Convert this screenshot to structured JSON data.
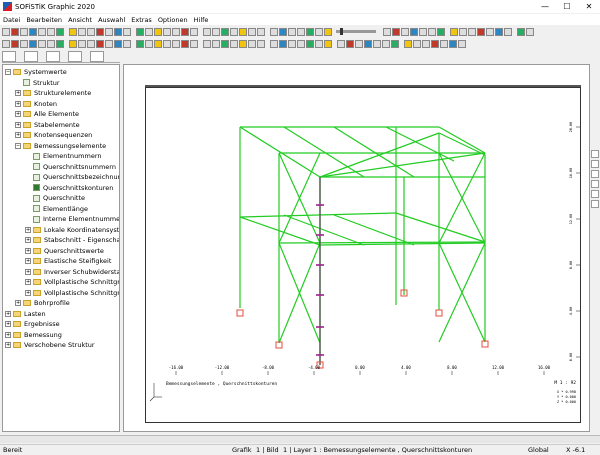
{
  "window": {
    "title": "SOFiSTiK Graphic 2020",
    "min": "—",
    "max": "☐",
    "close": "✕"
  },
  "menu": [
    "Datei",
    "Bearbeiten",
    "Ansicht",
    "Auswahl",
    "Extras",
    "Optionen",
    "Hilfe"
  ],
  "tree": [
    {
      "label": "Systemwerte",
      "level": 0,
      "exp": "−",
      "icon": "folder"
    },
    {
      "label": "Struktur",
      "level": 1,
      "exp": "",
      "icon": "doc"
    },
    {
      "label": "Strukturelemente",
      "level": 1,
      "exp": "+",
      "icon": "folder"
    },
    {
      "label": "Knoten",
      "level": 1,
      "exp": "+",
      "icon": "folder"
    },
    {
      "label": "Alle Elemente",
      "level": 1,
      "exp": "+",
      "icon": "folder"
    },
    {
      "label": "Stabelemente",
      "level": 1,
      "exp": "+",
      "icon": "folder"
    },
    {
      "label": "Knotensequenzen",
      "level": 1,
      "exp": "+",
      "icon": "folder"
    },
    {
      "label": "Bemessungselemente",
      "level": 1,
      "exp": "−",
      "icon": "folder"
    },
    {
      "label": "Elementnummern",
      "level": 2,
      "exp": "",
      "icon": "doc"
    },
    {
      "label": "Querschnittsnummern",
      "level": 2,
      "exp": "",
      "icon": "doc"
    },
    {
      "label": "Querschnittsbezeichnungen",
      "level": 2,
      "exp": "",
      "icon": "doc"
    },
    {
      "label": "Querschnittskonturen",
      "level": 2,
      "exp": "",
      "icon": "bold"
    },
    {
      "label": "Querschnitte",
      "level": 2,
      "exp": "",
      "icon": "doc"
    },
    {
      "label": "Elementlänge",
      "level": 2,
      "exp": "",
      "icon": "doc"
    },
    {
      "label": "Interne Elementnummern",
      "level": 2,
      "exp": "",
      "icon": "doc"
    },
    {
      "label": "Lokale Koordinatensysteme",
      "level": 2,
      "exp": "+",
      "icon": "folder"
    },
    {
      "label": "Stabschnitt - Eigenschaften",
      "level": 2,
      "exp": "+",
      "icon": "folder"
    },
    {
      "label": "Querschnittswerte",
      "level": 2,
      "exp": "+",
      "icon": "folder"
    },
    {
      "label": "Elastische Steifigkeit",
      "level": 2,
      "exp": "+",
      "icon": "folder"
    },
    {
      "label": "Inverser Schubwiderstand",
      "level": 2,
      "exp": "+",
      "icon": "folder"
    },
    {
      "label": "Vollplastische Schnittgröße,",
      "level": 2,
      "exp": "+",
      "icon": "folder"
    },
    {
      "label": "Vollplastische Schnittgröße,",
      "level": 2,
      "exp": "+",
      "icon": "folder"
    },
    {
      "label": "Bohrprofile",
      "level": 1,
      "exp": "+",
      "icon": "folder"
    },
    {
      "label": "Lasten",
      "level": 0,
      "exp": "+",
      "icon": "folder"
    },
    {
      "label": "Ergebnisse",
      "level": 0,
      "exp": "+",
      "icon": "folder"
    },
    {
      "label": "Bemessung",
      "level": 0,
      "exp": "+",
      "icon": "folder"
    },
    {
      "label": "Verschobene Struktur",
      "level": 0,
      "exp": "+",
      "icon": "folder"
    }
  ],
  "viewport": {
    "caption": "Bemessungselemente , Querschnittskonturen",
    "scale": "M 1 : 92",
    "xticks": [
      "-16.00",
      "-12.00",
      "-8.00",
      "-4.00",
      "0.00",
      "4.00",
      "8.00",
      "12.00",
      "16.00"
    ],
    "yticks": [
      "20.00",
      "16.00",
      "12.00",
      "8.00",
      "4.00",
      "0.00"
    ],
    "coords": [
      "X * 0.998",
      "Y * 0.000",
      "Z * 0.000"
    ],
    "line_color": "#22cc22",
    "support_color": "#e74c3c"
  },
  "status": {
    "ready": "Bereit",
    "grafik": "Grafik",
    "bild": "1 | Bild",
    "layer": "1 | Layer",
    "desc": "1 : Bemessungselemente , Querschnittskonturen",
    "global": "Global",
    "x": "X -6.1"
  }
}
